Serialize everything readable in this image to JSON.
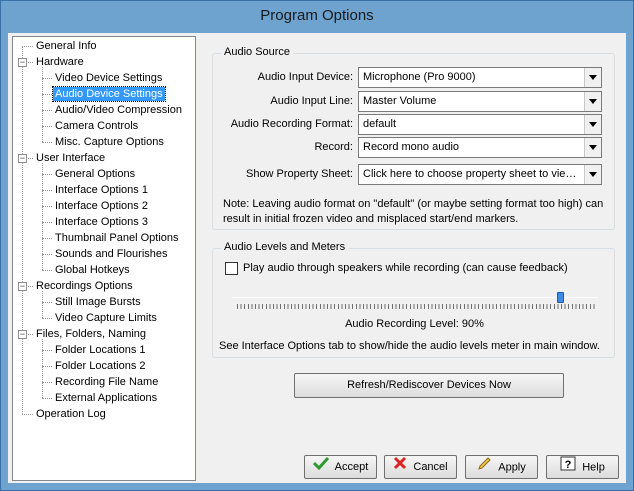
{
  "window": {
    "title": "Program Options"
  },
  "tree": [
    {
      "label": "General Info",
      "level": 0
    },
    {
      "label": "Hardware",
      "level": 0,
      "expanded": true
    },
    {
      "label": "Video Device Settings",
      "level": 1
    },
    {
      "label": "Audio Device Settings",
      "level": 1,
      "selected": true
    },
    {
      "label": "Audio/Video Compression",
      "level": 1
    },
    {
      "label": "Camera Controls",
      "level": 1
    },
    {
      "label": "Misc. Capture Options",
      "level": 1
    },
    {
      "label": "User Interface",
      "level": 0,
      "expanded": true
    },
    {
      "label": "General Options",
      "level": 1
    },
    {
      "label": "Interface Options 1",
      "level": 1
    },
    {
      "label": "Interface Options 2",
      "level": 1
    },
    {
      "label": "Interface Options 3",
      "level": 1
    },
    {
      "label": "Thumbnail Panel Options",
      "level": 1
    },
    {
      "label": "Sounds and Flourishes",
      "level": 1
    },
    {
      "label": "Global Hotkeys",
      "level": 1
    },
    {
      "label": "Recordings Options",
      "level": 0,
      "expanded": true
    },
    {
      "label": "Still Image Bursts",
      "level": 1
    },
    {
      "label": "Video Capture Limits",
      "level": 1
    },
    {
      "label": "Files, Folders, Naming",
      "level": 0,
      "expanded": true
    },
    {
      "label": "Folder Locations 1",
      "level": 1
    },
    {
      "label": "Folder Locations 2",
      "level": 1
    },
    {
      "label": "Recording File Name",
      "level": 1
    },
    {
      "label": "External Applications",
      "level": 1
    },
    {
      "label": "Operation Log",
      "level": 0
    }
  ],
  "audio_source": {
    "title": "Audio Source",
    "input_device": {
      "label": "Audio Input Device:",
      "value": "Microphone (Pro 9000)"
    },
    "input_line": {
      "label": "Audio Input Line:",
      "value": "Master Volume"
    },
    "recording_format": {
      "label": "Audio Recording Format:",
      "value": "default"
    },
    "record": {
      "label": "Record:",
      "value": "Record mono audio"
    },
    "property_sheet": {
      "label": "Show Property Sheet:",
      "value": "Click here to choose property sheet to view..."
    },
    "note": "Note: Leaving audio format on \"default\" (or maybe setting format too high) can result in initial frozen video and misplaced start/end markers."
  },
  "audio_levels": {
    "title": "Audio Levels and Meters",
    "play_through_label": "Play audio through speakers while recording (can cause feedback)",
    "play_through_checked": false,
    "level_label": "Audio Recording Level: 90%",
    "level_fraction": 0.9,
    "hint": "See Interface Options tab to show/hide the audio levels meter in main window."
  },
  "refresh_button": "Refresh/Rediscover Devices Now",
  "buttons": {
    "accept": "Accept",
    "cancel": "Cancel",
    "apply": "Apply",
    "help": "Help"
  },
  "colors": {
    "selection": "#3399ff",
    "titlebar": "#6fa3cf",
    "slider_thumb": "#3c8be4"
  }
}
